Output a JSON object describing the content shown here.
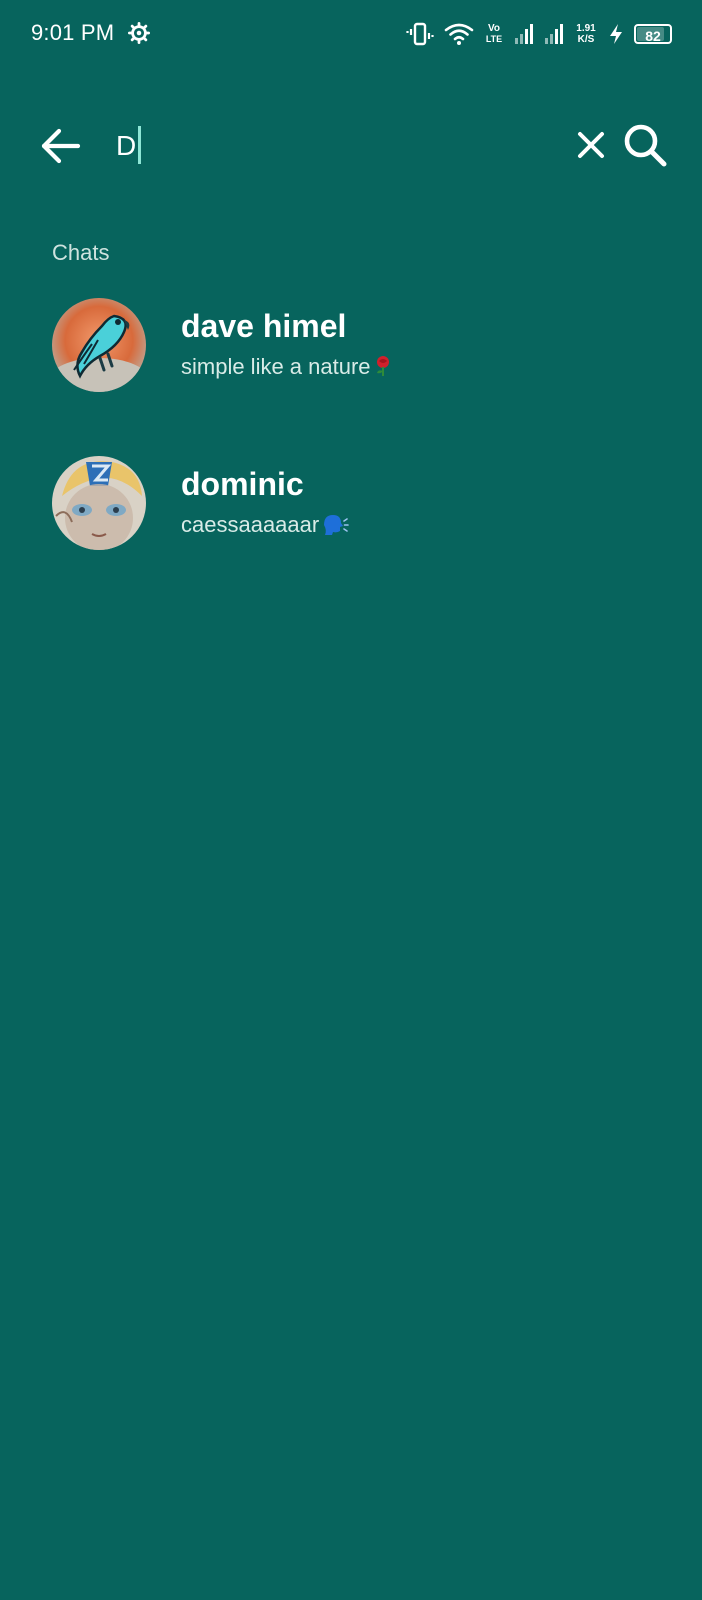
{
  "status_bar": {
    "time": "9:01 PM",
    "volte_top": "Vo",
    "volte_bottom": "LTE",
    "speed_value": "1.91",
    "speed_unit": "K/S",
    "battery": "82",
    "icons": [
      "gear-icon",
      "vibrate-icon",
      "wifi-icon",
      "signal-icon",
      "signal-icon",
      "charging-icon",
      "battery-icon"
    ]
  },
  "search": {
    "value": "D",
    "icons": [
      "back-arrow-icon",
      "clear-icon",
      "search-icon"
    ]
  },
  "section": {
    "label": "Chats"
  },
  "chats": [
    {
      "name": "dave himel",
      "message": "simple like a nature",
      "emoji": "rose",
      "avatar": "parrot"
    },
    {
      "name": "dominic",
      "message": "caessaaaaaar",
      "emoji": "speaking-head",
      "avatar": "portrait"
    }
  ],
  "colors": {
    "background": "#07645d",
    "cursor": "#8ee6d6",
    "subtext": "#d8ebe7"
  }
}
